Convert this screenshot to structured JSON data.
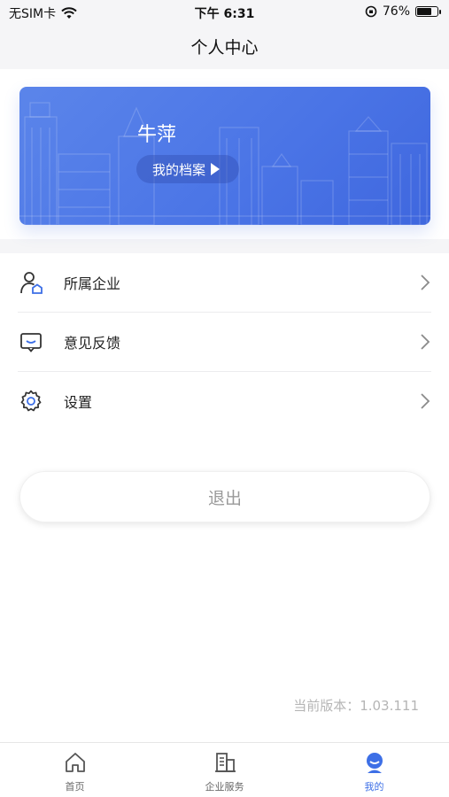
{
  "status_bar": {
    "carrier": "无SIM卡",
    "time": "下午 6:31",
    "battery_percent": "76%",
    "battery_level": 0.76
  },
  "nav": {
    "title": "个人中心"
  },
  "profile": {
    "name": "牛萍",
    "archive_label": "我的档案"
  },
  "menu": {
    "items": [
      {
        "label": "所属企业",
        "icon": "user-building-icon"
      },
      {
        "label": "意见反馈",
        "icon": "feedback-icon"
      },
      {
        "label": "设置",
        "icon": "gear-icon"
      }
    ]
  },
  "logout": {
    "label": "退出"
  },
  "version": {
    "text": "当前版本：1.03.111"
  },
  "tabs": [
    {
      "label": "首页",
      "icon": "home-icon",
      "active": false
    },
    {
      "label": "企业服务",
      "icon": "enterprise-service-icon",
      "active": false
    },
    {
      "label": "我的",
      "icon": "profile-icon",
      "active": true
    }
  ],
  "colors": {
    "accent": "#3d6fe6",
    "card_blue": "#4a74e6",
    "background": "#f5f5f7"
  }
}
